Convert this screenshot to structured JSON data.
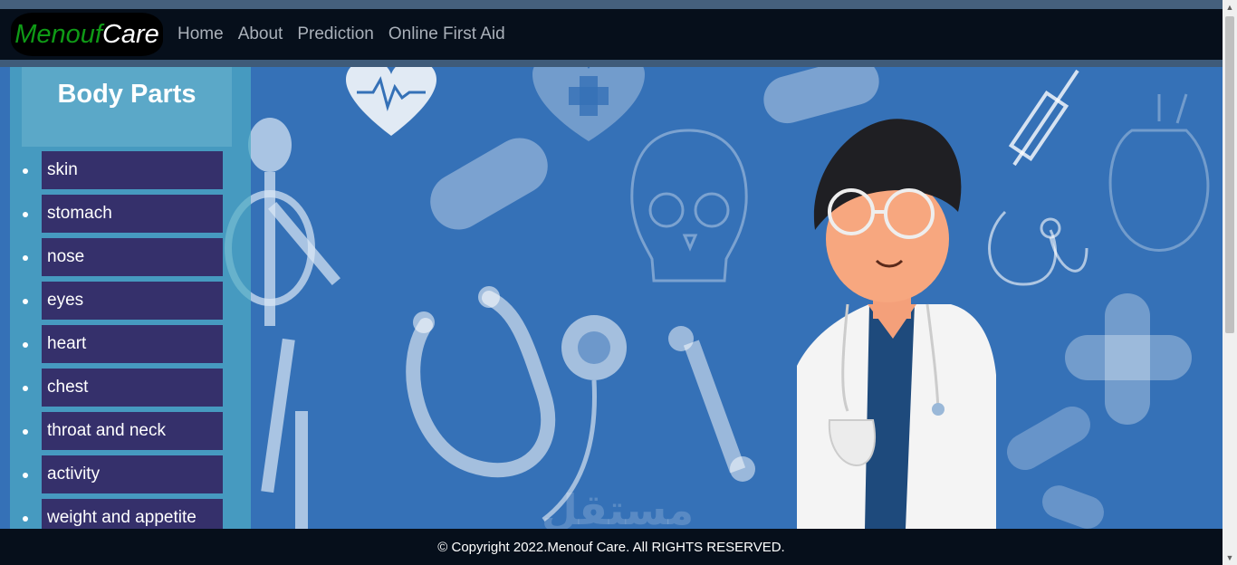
{
  "brand": {
    "part1": "Menouf",
    "part2": "Care"
  },
  "nav": {
    "items": [
      "Home",
      "About",
      "Prediction",
      "Online First Aid"
    ]
  },
  "sidebar": {
    "title": "Body Parts",
    "items": [
      "skin",
      "stomach",
      "nose",
      "eyes",
      "heart",
      "chest",
      "throat and neck",
      "activity",
      "weight and appetite"
    ]
  },
  "footer": {
    "text": "© Copyright 2022.Menouf Care. All RIGHTS RESERVED."
  },
  "icons": {
    "scroll_up": "chevron-up-icon",
    "scroll_down": "chevron-down-icon"
  },
  "colors": {
    "navbar": "#060f1b",
    "hero_bg": "#3571b7",
    "sidebar_button": "#35306b",
    "brand_green": "#0f9a16"
  }
}
